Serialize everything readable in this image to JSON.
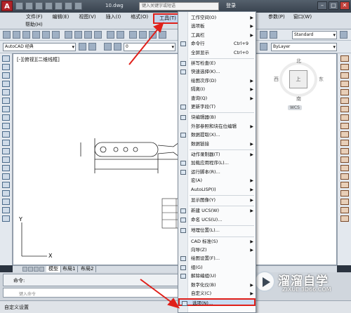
{
  "title_bar": {
    "logo": "A",
    "document": "10.dwg",
    "search_placeholder": "键入关键字或短语",
    "login_label": "登录",
    "window_buttons": [
      "–",
      "□",
      "✕"
    ]
  },
  "menubar": {
    "items": [
      "文件(F)",
      "编辑(E)",
      "视图(V)",
      "插入(I)",
      "格式(O)",
      "工具(T)"
    ],
    "active": "工具(T)",
    "right_items": [
      "参数(P)",
      "窗口(W)"
    ],
    "second_row": [
      "帮助(H)"
    ]
  },
  "toolbars": {
    "workspace": "AutoCAD 经典",
    "layer_value": "0",
    "text_style": "Standard",
    "linetype": "ByLayer"
  },
  "viewport": {
    "label": "[-][俯视][二维线框]",
    "viewcube": {
      "north": "北",
      "south": "南",
      "east": "东",
      "west": "西",
      "top": "上",
      "wcs": "WCS"
    }
  },
  "tabs": [
    "模型",
    "布局1",
    "布局2"
  ],
  "command": {
    "prompt": "命令:",
    "input_placeholder": "键入命令"
  },
  "status": {
    "text": "自定义设置"
  },
  "watermark": {
    "brand": "溜溜自学",
    "url": "ZIXUE.3D66.COM"
  },
  "tools_menu": {
    "items": [
      {
        "label": "工作空间(O)",
        "submenu": true
      },
      {
        "label": "选项板",
        "submenu": true
      },
      {
        "label": "工具栏",
        "submenu": true
      },
      {
        "label": "命令行",
        "shortcut": "Ctrl+9"
      },
      {
        "label": "全屏显示",
        "shortcut": "Ctrl+0"
      },
      {
        "label": "拼写检查(E)"
      },
      {
        "label": "快速选择(K)..."
      },
      {
        "label": "绘图次序(D)",
        "submenu": true
      },
      {
        "label": "隔离(I)",
        "submenu": true
      },
      {
        "label": "查询(Q)",
        "submenu": true
      },
      {
        "label": "更新字段(T)"
      },
      {
        "label": "块编辑器(B)"
      },
      {
        "label": "外部参照和块在位编辑",
        "submenu": true
      },
      {
        "label": "数据提取(X)..."
      },
      {
        "label": "数据链接",
        "submenu": true
      },
      {
        "label": "动作录制器(T)",
        "submenu": true
      },
      {
        "label": "加载应用程序(L)..."
      },
      {
        "label": "运行脚本(R)..."
      },
      {
        "label": "宏(A)",
        "submenu": true
      },
      {
        "label": "AutoLISP(I)",
        "submenu": true
      },
      {
        "label": "显示图像(Y)",
        "submenu": true
      },
      {
        "label": "新建 UCS(W)",
        "submenu": true
      },
      {
        "label": "命名 UCS(U)..."
      },
      {
        "label": "地理位置(L)..."
      },
      {
        "label": "CAD 标准(S)",
        "submenu": true
      },
      {
        "label": "向导(Z)",
        "submenu": true
      },
      {
        "label": "绘图设置(F)..."
      },
      {
        "label": "组(G)"
      },
      {
        "label": "解除编组(U)"
      },
      {
        "label": "数字化仪(B)",
        "submenu": true
      },
      {
        "label": "自定义(C)",
        "submenu": true
      },
      {
        "label": "选项(N)..."
      }
    ],
    "highlighted": "选项(N)..."
  },
  "colors": {
    "accent_red": "#e0201a",
    "menu_highlight": "#c9dbf1"
  }
}
